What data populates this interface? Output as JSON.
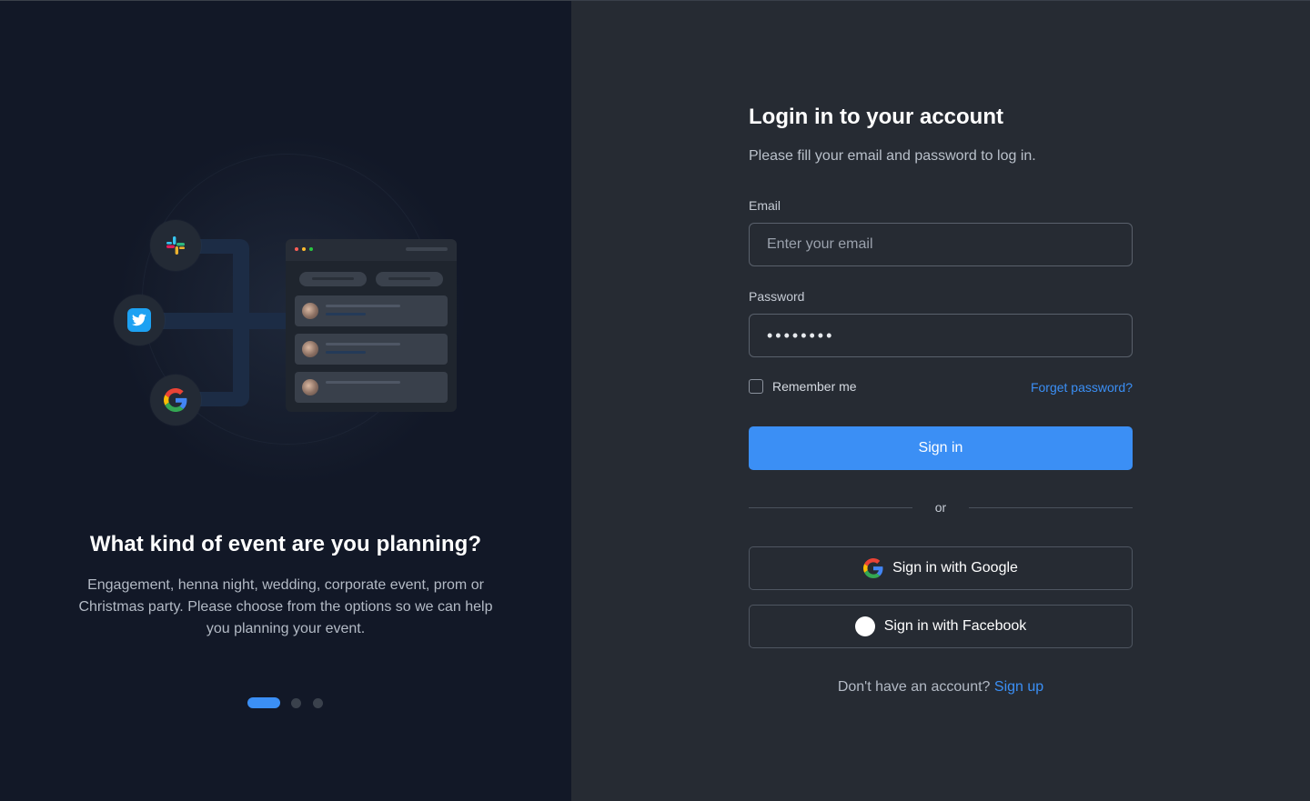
{
  "left_panel": {
    "title": "What kind of event are you planning?",
    "description": "Engagement, henna night, wedding, corporate event, prom or Christmas party. Please choose from the options so we can help you planning your event.",
    "pager": {
      "count": 3,
      "active_index": 0
    },
    "illustration": {
      "apps": [
        "slack-icon",
        "twitter-icon",
        "google-icon"
      ]
    }
  },
  "login": {
    "title": "Login in to your account",
    "subtitle": "Please fill your email and password to log in.",
    "email_label": "Email",
    "email_placeholder": "Enter your email",
    "password_label": "Password",
    "password_value": "••••••••",
    "remember_label": "Remember me",
    "remember_checked": false,
    "forgot_label": "Forget password?",
    "signin_label": "Sign in",
    "or_label": "or",
    "google_label": "Sign in with Google",
    "facebook_label": "Sign in with Facebook",
    "no_account_text": "Don't have an account?",
    "signup_label": "Sign up"
  },
  "colors": {
    "accent": "#3b8ff5",
    "left_bg": "#121827",
    "right_bg": "#262b33"
  }
}
